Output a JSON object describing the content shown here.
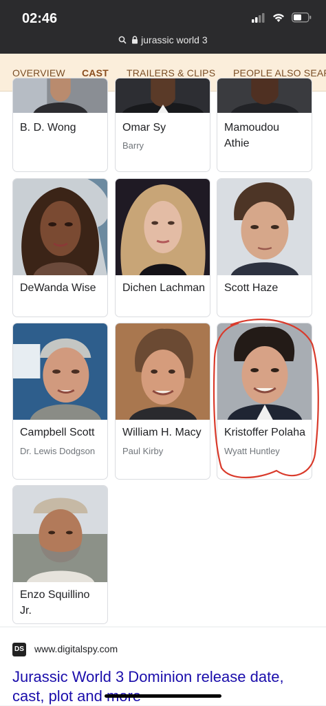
{
  "status": {
    "time": "02:46",
    "url": "jurassic world 3"
  },
  "tabs": [
    {
      "label": "OVERVIEW"
    },
    {
      "label": "CAST"
    },
    {
      "label": "TRAILERS & CLIPS"
    },
    {
      "label": "PEOPLE ALSO SEARCH FOR"
    }
  ],
  "cast": [
    {
      "name": "B. D. Wong",
      "role": ""
    },
    {
      "name": "Omar Sy",
      "role": "Barry"
    },
    {
      "name": "Mamoudou Athie",
      "role": ""
    },
    {
      "name": "DeWanda Wise",
      "role": ""
    },
    {
      "name": "Dichen Lachman",
      "role": ""
    },
    {
      "name": "Scott Haze",
      "role": ""
    },
    {
      "name": "Campbell Scott",
      "role": "Dr. Lewis Dodgson"
    },
    {
      "name": "William H. Macy",
      "role": "Paul Kirby"
    },
    {
      "name": "Kristoffer Polaha",
      "role": "Wyatt Huntley"
    },
    {
      "name": "Enzo Squillino Jr.",
      "role": ""
    }
  ],
  "result": {
    "favicon": "DS",
    "site": "www.digitalspy.com",
    "headline": "Jurassic World 3 Dominion release date, cast, plot and more"
  },
  "colors": {
    "tab_bg": "#fbeedb",
    "tab_text": "#7a4e26",
    "link": "#1a0dab",
    "annotation": "#d93a2b"
  }
}
